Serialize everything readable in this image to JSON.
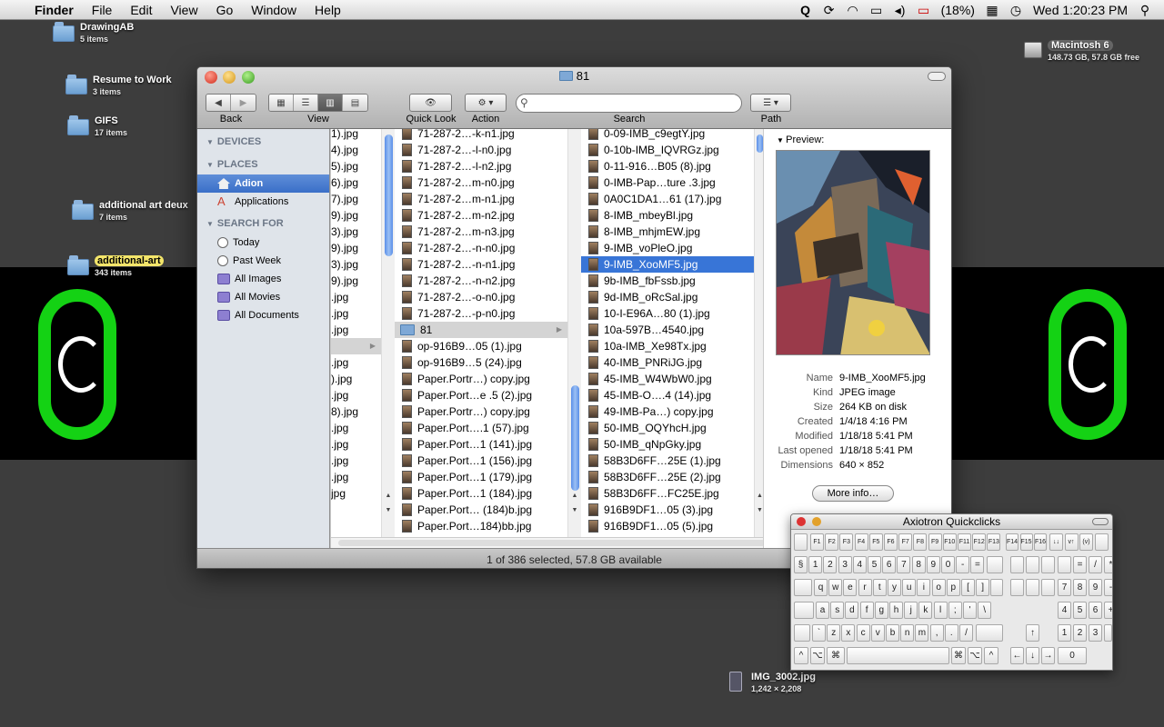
{
  "menubar": {
    "app_name": "Finder",
    "menus": [
      "File",
      "Edit",
      "View",
      "Go",
      "Window",
      "Help"
    ],
    "battery": "(18%)",
    "clock": "Wed 1:20:23 PM"
  },
  "desktop": {
    "folders": [
      {
        "name": "DrawingAB",
        "count": "5 items"
      },
      {
        "name": "Resume to Work",
        "count": "3 items"
      },
      {
        "name": "GIFS",
        "count": "17 items"
      },
      {
        "name": "additional art deux",
        "count": "7 items"
      },
      {
        "name": "additional-art",
        "count": "343 items"
      }
    ],
    "drive": {
      "name": "Macintosh 6",
      "info": "148.73 GB, 57.8 GB free"
    },
    "file": {
      "name": "IMG_3002.jpg",
      "dims": "1,242 × 2,208"
    }
  },
  "finder": {
    "title": "81",
    "toolbar": {
      "back": "Back",
      "view": "View",
      "quicklook": "Quick Look",
      "action": "Action",
      "search": "Search",
      "path": "Path"
    },
    "sidebar": {
      "devices_header": "DEVICES",
      "places_header": "PLACES",
      "places": [
        "Adion",
        "Applications"
      ],
      "search_header": "SEARCH FOR",
      "searches": [
        "Today",
        "Past Week",
        "All Images",
        "All Movies",
        "All Documents"
      ]
    },
    "col1": [
      "1).jpg",
      "4).jpg",
      "5).jpg",
      "6).jpg",
      "7).jpg",
      "9).jpg",
      "3).jpg",
      "9).jpg",
      "3).jpg",
      "9).jpg",
      ".jpg",
      ".jpg",
      ".jpg",
      "",
      ".jpg",
      ").jpg",
      ".jpg",
      "8).jpg",
      ".jpg",
      ".jpg",
      ".jpg",
      ".jpg",
      "jpg"
    ],
    "col2": [
      "71-287-2…-k-n1.jpg",
      "71-287-2…-l-n0.jpg",
      "71-287-2…-l-n2.jpg",
      "71-287-2…m-n0.jpg",
      "71-287-2…m-n1.jpg",
      "71-287-2…m-n2.jpg",
      "71-287-2…m-n3.jpg",
      "71-287-2…-n-n0.jpg",
      "71-287-2…-n-n1.jpg",
      "71-287-2…-n-n2.jpg",
      "71-287-2…-o-n0.jpg",
      "71-287-2…-p-n0.jpg",
      "81",
      "op-916B9…05 (1).jpg",
      "op-916B9…5 (24).jpg",
      "Paper.Portr…) copy.jpg",
      "Paper.Port…e .5 (2).jpg",
      "Paper.Portr…) copy.jpg",
      "Paper.Port….1 (57).jpg",
      "Paper.Port…1 (141).jpg",
      "Paper.Port…1 (156).jpg",
      "Paper.Port…1 (179).jpg",
      "Paper.Port…1 (184).jpg",
      "Paper.Port… (184)b.jpg",
      "Paper.Port…184)bb.jpg"
    ],
    "col3": [
      "0-09-IMB_c9egtY.jpg",
      "0-10b-IMB_IQVRGz.jpg",
      "0-11-916…B05 (8).jpg",
      "0-IMB-Pap…ture .3.jpg",
      "0A0C1DA1…61 (17).jpg",
      "8-IMB_mbeyBl.jpg",
      "8-IMB_mhjmEW.jpg",
      "9-IMB_voPleO.jpg",
      "9-IMB_XooMF5.jpg",
      "9b-IMB_fbFssb.jpg",
      "9d-IMB_oRcSal.jpg",
      "10-I-E96A…80 (1).jpg",
      "10a-597B…4540.jpg",
      "10a-IMB_Xe98Tx.jpg",
      "40-IMB_PNRiJG.jpg",
      "45-IMB_W4WbW0.jpg",
      "45-IMB-O….4 (14).jpg",
      "49-IMB-Pa…) copy.jpg",
      "50-IMB_OQYhcH.jpg",
      "50-IMB_qNpGky.jpg",
      "58B3D6FF…25E (1).jpg",
      "58B3D6FF…25E (2).jpg",
      "58B3D6FF…FC25E.jpg",
      "916B9DF1…05 (3).jpg",
      "916B9DF1…05 (5).jpg"
    ],
    "preview": {
      "header": "Preview:",
      "meta": [
        {
          "k": "Name",
          "v": "9-IMB_XooMF5.jpg"
        },
        {
          "k": "Kind",
          "v": "JPEG image"
        },
        {
          "k": "Size",
          "v": "264 KB on disk"
        },
        {
          "k": "Created",
          "v": "1/4/18 4:16 PM"
        },
        {
          "k": "Modified",
          "v": "1/18/18 5:41 PM"
        },
        {
          "k": "Last opened",
          "v": "1/18/18 5:41 PM"
        },
        {
          "k": "Dimensions",
          "v": "640 × 852"
        }
      ],
      "more_info": "More info…"
    },
    "status": "1 of 386 selected, 57.8 GB available"
  },
  "keyboard": {
    "title": "Axiotron Quickclicks",
    "keys": {
      "fn": [
        "F1",
        "F2",
        "F3",
        "F4",
        "F5",
        "F6",
        "F7",
        "F8",
        "F9",
        "F10",
        "F11",
        "F12",
        "F13"
      ],
      "fn2": [
        "F14",
        "F15",
        "F16"
      ],
      "nav": [
        "↓↓",
        "v↑",
        "(v)"
      ],
      "num_row": [
        "§",
        "1",
        "2",
        "3",
        "4",
        "5",
        "6",
        "7",
        "8",
        "9",
        "0",
        "-",
        "="
      ],
      "q_row": [
        "q",
        "w",
        "e",
        "r",
        "t",
        "y",
        "u",
        "i",
        "o",
        "p",
        "[",
        "]"
      ],
      "a_row": [
        "a",
        "s",
        "d",
        "f",
        "g",
        "h",
        "j",
        "k",
        "l",
        ";",
        "'",
        "\\"
      ],
      "z_row": [
        "`",
        "z",
        "x",
        "c",
        "v",
        "b",
        "n",
        "m",
        ",",
        ".",
        "/"
      ],
      "pad": [
        "=",
        "/",
        "*",
        "7",
        "8",
        "9",
        "-",
        "4",
        "5",
        "6",
        "+",
        "1",
        "2",
        "3",
        "0"
      ],
      "arrows": [
        "←",
        "↓",
        "→",
        "↑"
      ],
      "mods": [
        "^",
        "⌥",
        "⌘",
        "⌘",
        "⌥",
        "^"
      ]
    }
  },
  "colors": {
    "selection": "#3875d7",
    "logo_green": "#14d214"
  }
}
